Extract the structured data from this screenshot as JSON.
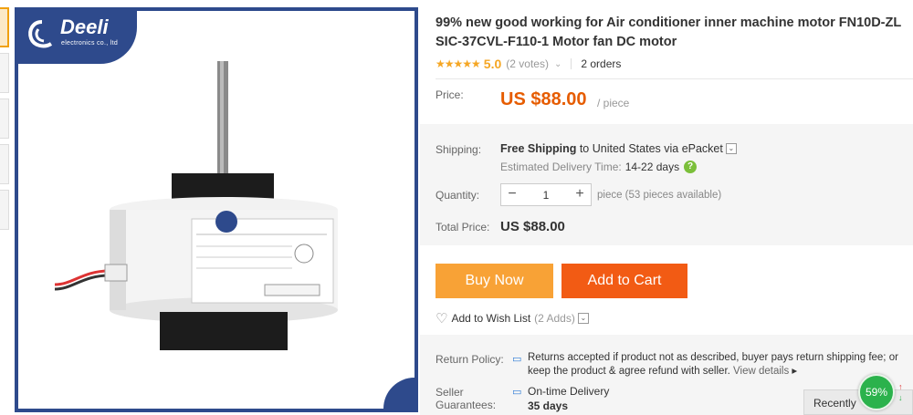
{
  "brand": {
    "name": "Deeli",
    "tagline": "electronics co., ltd"
  },
  "product": {
    "title": "99% new good working for Air conditioner inner machine motor FN10D-ZL SIC-37CVL-F110-1 Motor fan DC motor",
    "stars": "★★★★★",
    "rating": "5.0",
    "votes": "(2 votes)",
    "orders": "2 orders"
  },
  "price": {
    "label": "Price:",
    "value": "US $88.00",
    "unit": "/ piece"
  },
  "shipping": {
    "label": "Shipping:",
    "free": "Free Shipping",
    "to": "to United States via ePacket",
    "est_label": "Estimated Delivery Time:",
    "est_days": "14-22 days"
  },
  "quantity": {
    "label": "Quantity:",
    "value": "1",
    "minus": "−",
    "plus": "+",
    "available": "piece (53 pieces available)"
  },
  "total": {
    "label": "Total Price:",
    "value": "US $88.00"
  },
  "actions": {
    "buy_now": "Buy Now",
    "add_to_cart": "Add to Cart",
    "wish_list": "Add to Wish List",
    "wish_adds": "(2 Adds)"
  },
  "return_policy": {
    "label": "Return Policy:",
    "text": "Returns accepted if product not as described, buyer pays return shipping fee; or keep the product & agree refund with seller.",
    "view_details": "View details"
  },
  "seller_guarantees": {
    "label": "Seller Guarantees:",
    "title": "On-time Delivery",
    "days": "35 days"
  },
  "widgets": {
    "recently": "Recently",
    "badge": "59%"
  },
  "colors": {
    "accent_orange": "#e65c00",
    "buy_now": "#f8a236",
    "add_to_cart": "#f25b14",
    "brand_blue": "#2e4a8c",
    "star": "#f5a623"
  },
  "icons": [
    "search-icon",
    "heart-icon",
    "help-icon",
    "return-icon",
    "clock-icon",
    "chevron-down-icon"
  ]
}
